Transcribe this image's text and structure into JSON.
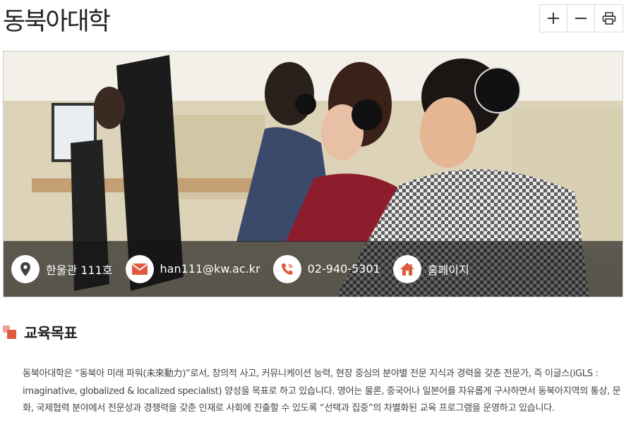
{
  "header": {
    "title": "동북아대학"
  },
  "toolbar": {
    "zoom_in_icon": "plus-icon",
    "zoom_out_icon": "minus-icon",
    "print_icon": "printer-icon"
  },
  "info": {
    "location": "한울관 111호",
    "email": "han111@kw.ac.kr",
    "phone": "02-940-5301",
    "homepage": "홈페이지"
  },
  "section": {
    "title": "교육목표",
    "paragraph": "동북아대학은 “동북아 미래 파워(未來動力)”로서, 창의적 사고, 커뮤니케이션 능력, 현장 중심의 분야별 전문 지식과 경력을 갖춘 전문가, 즉 이글스(iGLS : imaginative, globalized & localized specialist) 양성을 목표로 하고 있습니다. 영어는 물론, 중국어나 일본어를 자유롭게 구사하면서 동북아지역의 통상, 문화, 국제협력 분야에서 전문성과 경쟁력을 갖춘 인재로 사회에 진출할 수 있도록 “선택과 집중”의 차별화된 교육 프로그램을 운영하고 있습니다."
  },
  "colors": {
    "accent": "#e05a40",
    "accent_light": "#f0a090",
    "overlay": "#141414"
  }
}
